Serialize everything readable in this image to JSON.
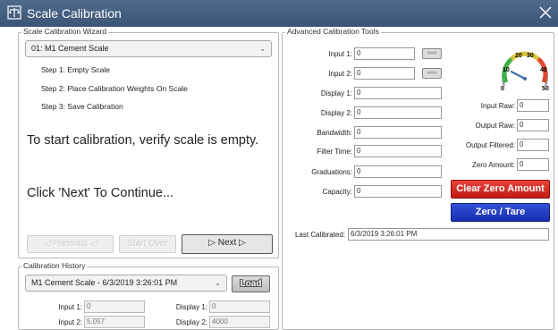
{
  "window": {
    "title": "Scale Calibration",
    "icon": "scale-icon"
  },
  "wizard": {
    "legend": "Scale Calibration Wizard",
    "selected_scale": "01: M1 Cement Scale",
    "steps": [
      "Step 1: Empty Scale",
      "Step 2: Place Calibration Weights On Scale",
      "Step 3: Save Calibration"
    ],
    "instruction": "To start calibration, verify scale is empty.",
    "continue_text": "Click 'Next' To Continue...",
    "previous_label": "◁ Previous ◁",
    "start_over_label": "Start Over",
    "next_label": "▷ Next ▷"
  },
  "history": {
    "legend": "Calibration History",
    "selected": "M1 Cement Scale - 6/3/2019 3:26:01 PM",
    "load_label": "Load",
    "input1_label": "Input 1:",
    "input1_value": "0",
    "input2_label": "Input 2:",
    "input2_value": "5.057",
    "display1_label": "Display 1:",
    "display1_value": "0",
    "display2_label": "Display 2:",
    "display2_value": "4000"
  },
  "advanced": {
    "legend": "Advanced Calibration Tools",
    "fields": [
      {
        "label": "Input 1:",
        "value": "0"
      },
      {
        "label": "Input 2:",
        "value": "0"
      },
      {
        "label": "Display 1:",
        "value": "0"
      },
      {
        "label": "Display 2:",
        "value": "0"
      },
      {
        "label": "Bandwidth:",
        "value": "0"
      },
      {
        "label": "Filter Time:",
        "value": "0"
      },
      {
        "label": "Graduations:",
        "value": "0"
      },
      {
        "label": "Capacity:",
        "value": "0"
      }
    ],
    "gauge": {
      "ticks": [
        "0",
        "10",
        "20",
        "30",
        "40",
        "50"
      ],
      "value": 12
    },
    "raw": [
      {
        "label": "Input Raw:",
        "value": "0"
      },
      {
        "label": "Output Raw:",
        "value": "0"
      },
      {
        "label": "Output Filtered:",
        "value": "0"
      },
      {
        "label": "Zero Amount:",
        "value": "0"
      }
    ],
    "clear_zero_label": "Clear Zero Amount",
    "zero_tare_label": "Zero / Tare",
    "last_calibrated_label": "Last Calibrated:",
    "last_calibrated_value": "6/3/2019 3:26:01 PM"
  },
  "colors": {
    "titlebar": "#3b5576",
    "red_button": "#c21b14",
    "blue_button": "#1a2fb0"
  }
}
